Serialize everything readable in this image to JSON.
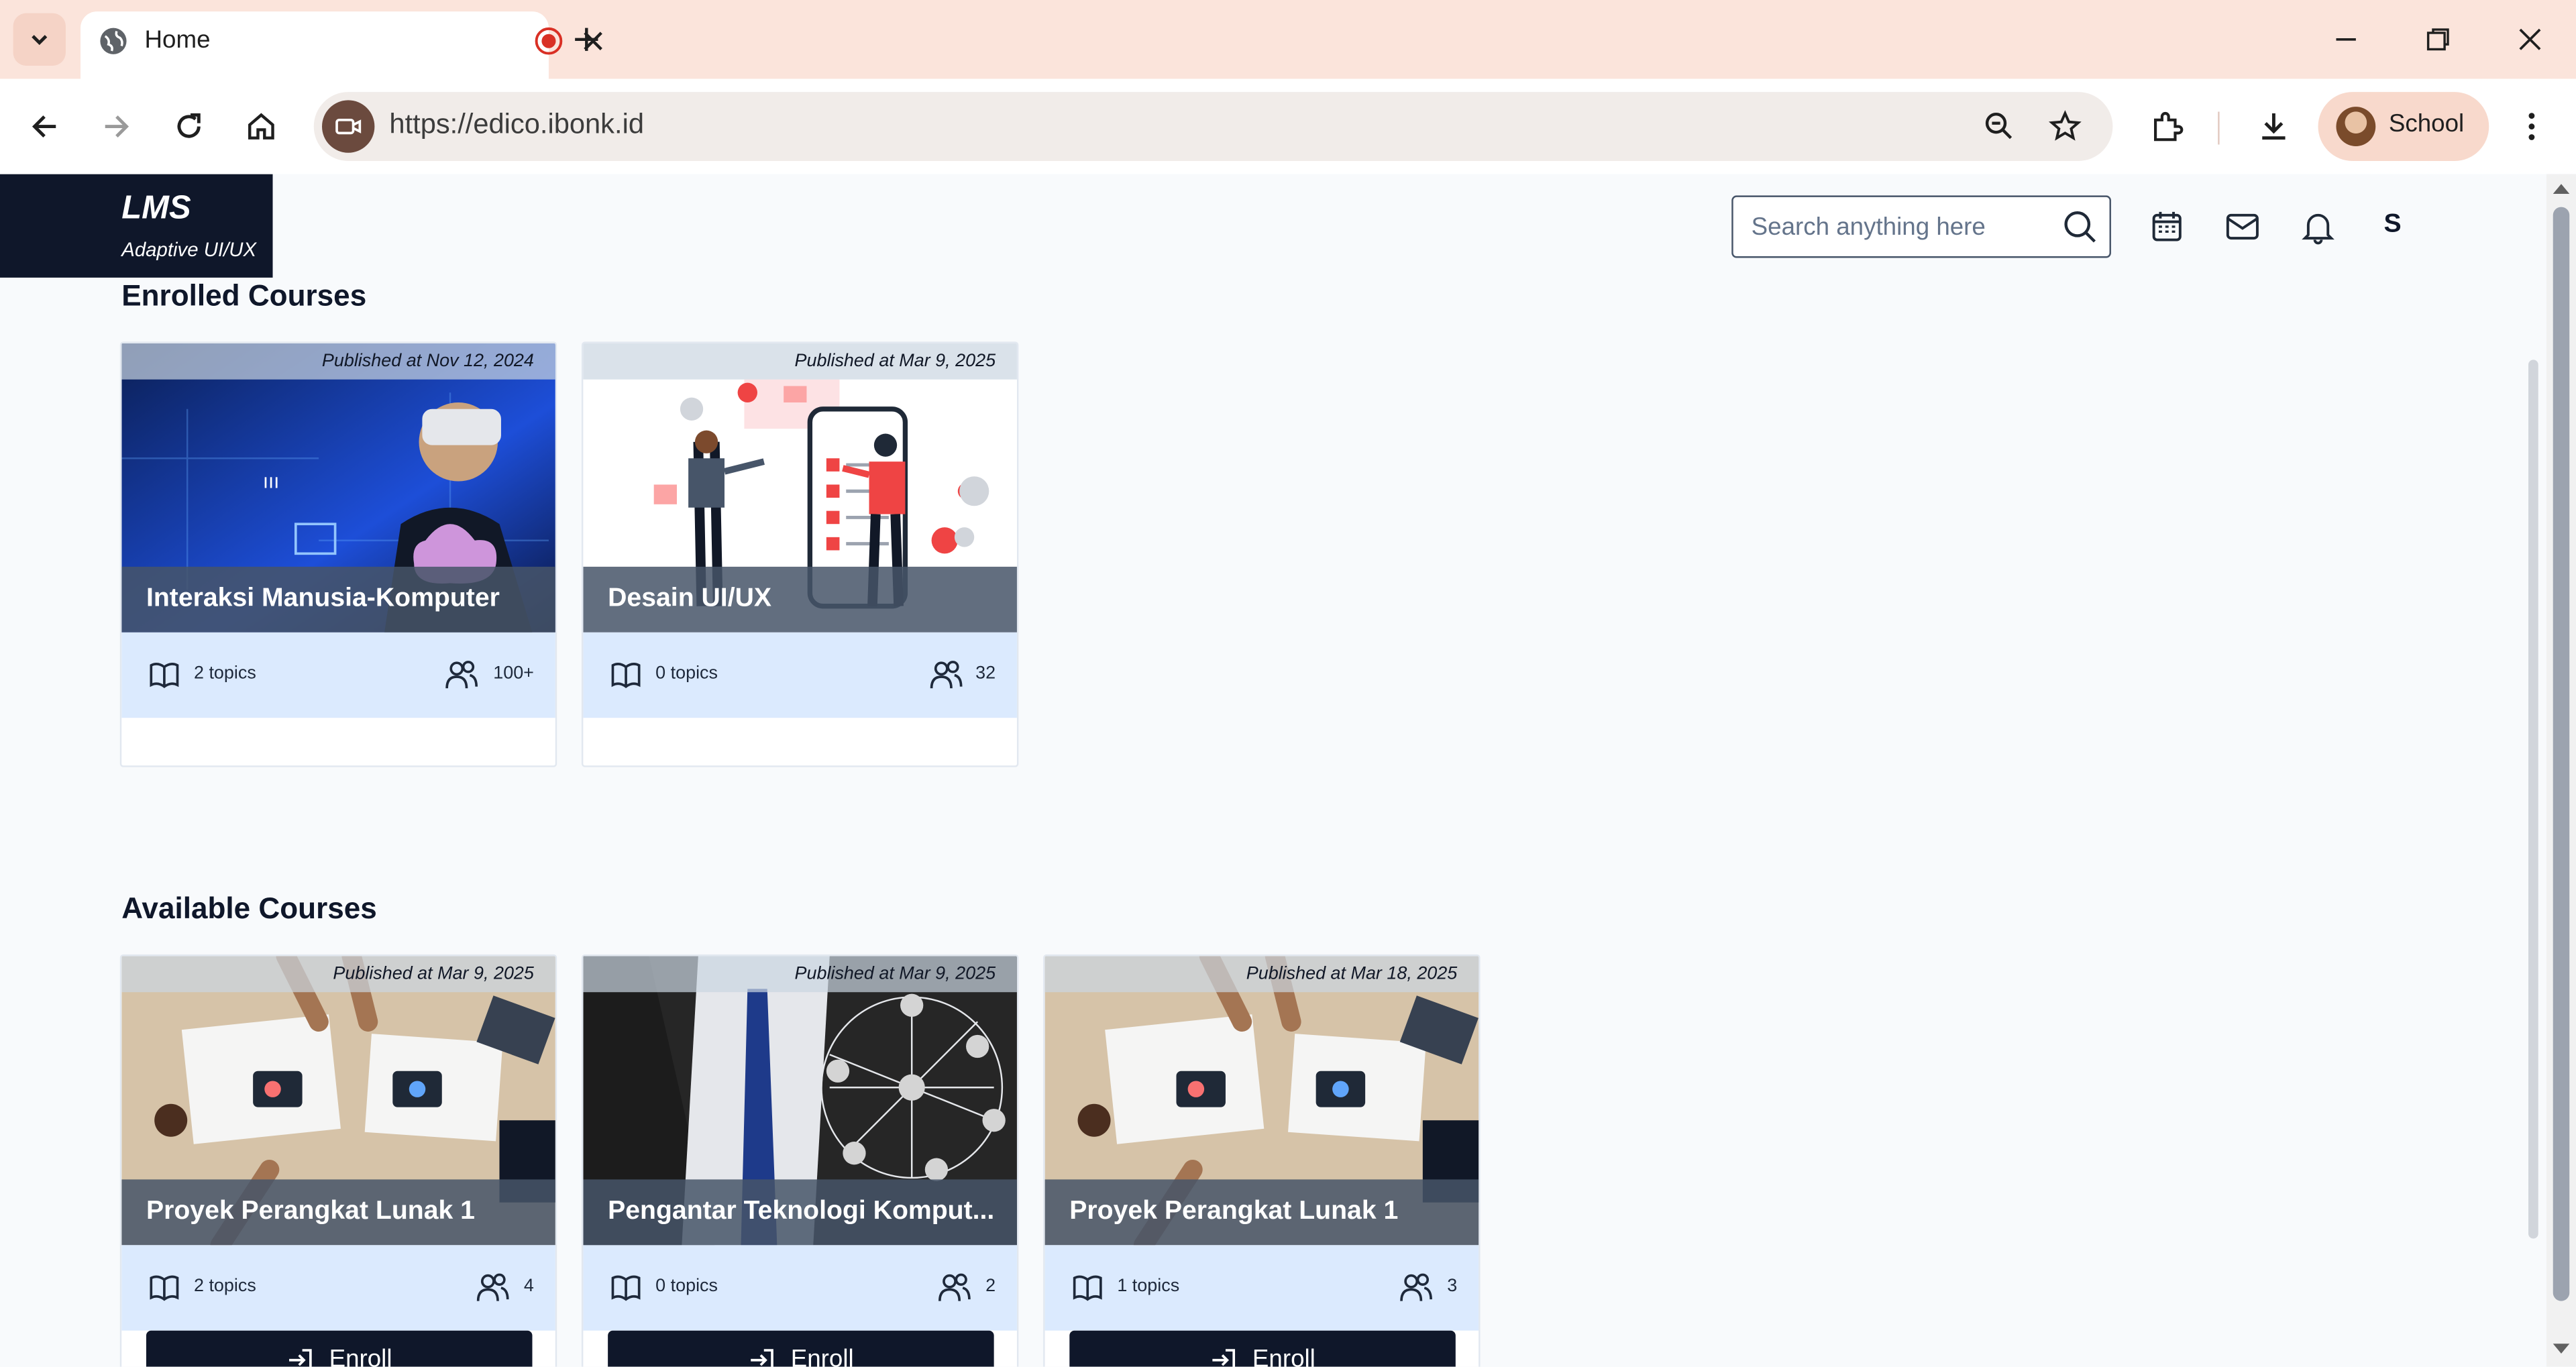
{
  "browser": {
    "tab_title": "Home",
    "url": "https://edico.ibonk.id",
    "profile_name": "School"
  },
  "app": {
    "logo_title": "LMS",
    "logo_subtitle": "Adaptive UI/UX",
    "search_placeholder": "Search anything here",
    "user_initial": "S"
  },
  "enrolled": {
    "heading": "Enrolled Courses",
    "courses": [
      {
        "published": "Published at Nov 12, 2024",
        "title": "Interaksi Manusia-Komputer",
        "topics": "2 topics",
        "members": "100+"
      },
      {
        "published": "Published at Mar 9, 2025",
        "title": "Desain UI/UX",
        "topics": "0 topics",
        "members": "32"
      }
    ]
  },
  "available": {
    "heading": "Available Courses",
    "enroll_label": "Enroll",
    "courses": [
      {
        "published": "Published at Mar 9, 2025",
        "title": "Proyek Perangkat Lunak 1",
        "topics": "2 topics",
        "members": "4"
      },
      {
        "published": "Published at Mar 9, 2025",
        "title": "Pengantar Teknologi Komput...",
        "topics": "0 topics",
        "members": "2"
      },
      {
        "published": "Published at Mar 18, 2025",
        "title": "Proyek Perangkat Lunak 1",
        "topics": "1 topics",
        "members": "3"
      }
    ]
  },
  "colors": {
    "accent_dark": "#0f172a",
    "meta_bg": "#dbeafe",
    "tabstrip_bg": "#fbe4db"
  }
}
